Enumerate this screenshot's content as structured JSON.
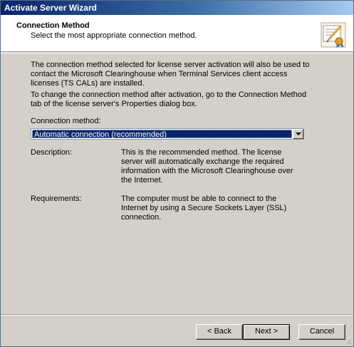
{
  "window": {
    "title": "Activate Server Wizard"
  },
  "header": {
    "title": "Connection Method",
    "subtitle": "Select the most appropriate connection method."
  },
  "body": {
    "paragraph1": "The connection method selected for license server activation will also be used to contact the Microsoft Clearinghouse when Terminal Services client access licenses (TS CALs) are installed.",
    "paragraph2": "To change the connection method after activation, go to the Connection Method tab of the license server's Properties dialog box.",
    "connection_method_label": "Connection method:",
    "connection_method_value": "Automatic connection (recommended)",
    "description_label": "Description:",
    "description_text": "This is the recommended method. The license server will automatically exchange the required information with the Microsoft Clearinghouse over the Internet.",
    "requirements_label": "Requirements:",
    "requirements_text": "The computer must be able to connect to the Internet by using a Secure Sockets Layer (SSL) connection."
  },
  "buttons": {
    "back": "< Back",
    "next": "Next >",
    "cancel": "Cancel"
  },
  "colors": {
    "selection": "#0a246a",
    "dialog_bg": "#d4d0c8"
  },
  "icons": {
    "header_icon": "certificate-wizard-icon",
    "dropdown": "chevron-down-icon"
  }
}
